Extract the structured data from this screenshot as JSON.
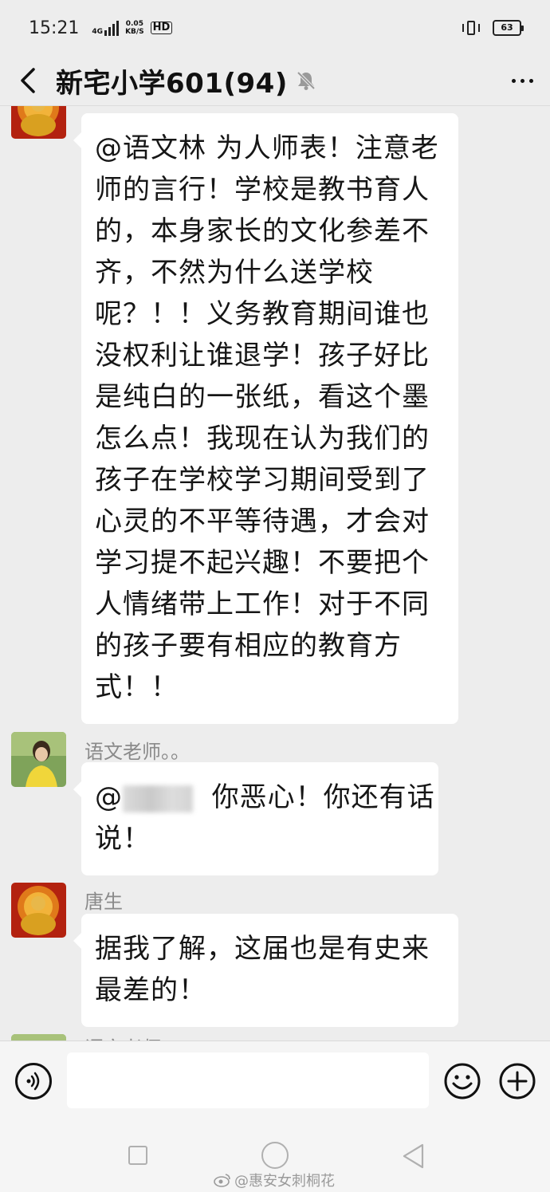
{
  "status_bar": {
    "time": "15:21",
    "network": "4G",
    "speed_value": "0.05",
    "speed_unit": "KB/S",
    "hd": "HD",
    "battery": "63"
  },
  "header": {
    "title": "新宅小学601(94)"
  },
  "messages": [
    {
      "sender": "",
      "lines": [
        "@语文林  为人师表！注意老",
        "师的言行！学校是教书育人",
        "的，本身家长的文化参差不",
        "齐，不然为什么送学校",
        "呢？！！义务教育期间谁也",
        "没权利让谁退学！孩子好比",
        "是纯白的一张纸，看这个墨",
        "怎么点！我现在认为我们的",
        "孩子在学校学习期间受到了",
        "心灵的不平等待遇，才会对",
        "学习提不起兴趣！不要把个",
        "人情绪带上工作！对于不同",
        "的孩子要有相应的教育方",
        "式！！"
      ]
    },
    {
      "sender": "语文老师。。",
      "mention": "@",
      "lines": [
        "你恶心！你还有话",
        "说！"
      ]
    },
    {
      "sender": "唐生",
      "lines": [
        "据我了解，这届也是有史来",
        "最差的！"
      ]
    },
    {
      "sender": "语文老师"
    }
  ],
  "watermark": "@惠安女刺桐花"
}
